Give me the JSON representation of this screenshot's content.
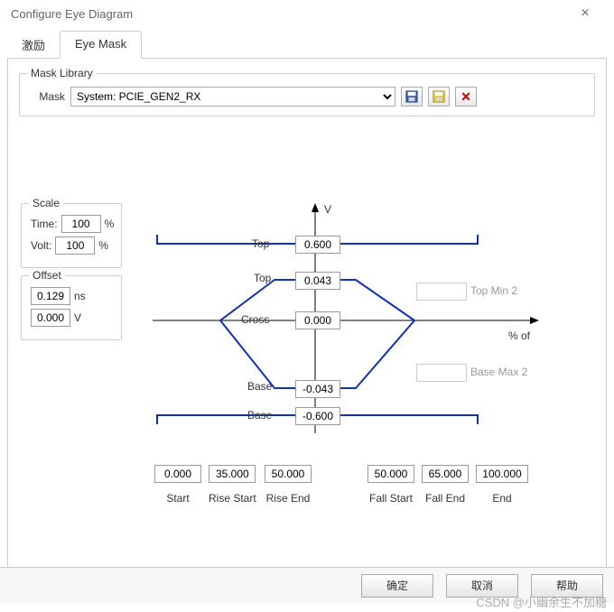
{
  "window": {
    "title": "Configure Eye Diagram"
  },
  "tabs": [
    {
      "label": "激励"
    },
    {
      "label": "Eye Mask"
    }
  ],
  "mask_library": {
    "title": "Mask Library",
    "label": "Mask",
    "selected": "System: PCIE_GEN2_RX"
  },
  "scale": {
    "title": "Scale",
    "time_label": "Time:",
    "time_value": "100",
    "time_unit": "%",
    "volt_label": "Volt:",
    "volt_value": "100",
    "volt_unit": "%"
  },
  "offset": {
    "title": "Offset",
    "time_value": "0.129",
    "time_unit": "ns",
    "volt_value": "0.000",
    "volt_unit": "V"
  },
  "diagram": {
    "v_label": "V",
    "pctof_label": "% of",
    "top_outer_label": "Top",
    "top_inner_label": "Top",
    "base_inner_label": "Base",
    "base_outer_label": "Base",
    "cross_label": "Cross",
    "topmin2": "Top Min 2",
    "basemax2": "Base Max 2",
    "top_outer": "0.600",
    "top_inner": "0.043",
    "cross": "0.000",
    "base_inner": "-0.043",
    "base_outer": "-0.600"
  },
  "times": {
    "start": {
      "v": "0.000",
      "l": "Start"
    },
    "rise_start": {
      "v": "35.000",
      "l": "Rise Start"
    },
    "rise_end": {
      "v": "50.000",
      "l": "Rise End"
    },
    "fall_start": {
      "v": "50.000",
      "l": "Fall Start"
    },
    "fall_end": {
      "v": "65.000",
      "l": "Fall End"
    },
    "end": {
      "v": "100.000",
      "l": "End"
    }
  },
  "buttons": {
    "ok": "确定",
    "cancel": "取消",
    "help": "帮助"
  },
  "watermark": "CSDN @小幽余生不加糖",
  "chart_data": {
    "type": "diagram",
    "description": "Eye mask polygon over % of UI (x) vs Volts (y)",
    "xlim": [
      0,
      100
    ],
    "xlabel": "% of UI",
    "ylabel": "V",
    "outer_mask": {
      "top": 0.6,
      "base": -0.6,
      "start": 0.0,
      "end": 100.0
    },
    "inner_mask": {
      "top": 0.043,
      "base": -0.043,
      "cross": 0.0,
      "rise_start": 35.0,
      "rise_end": 50.0,
      "fall_start": 50.0,
      "fall_end": 65.0
    }
  }
}
